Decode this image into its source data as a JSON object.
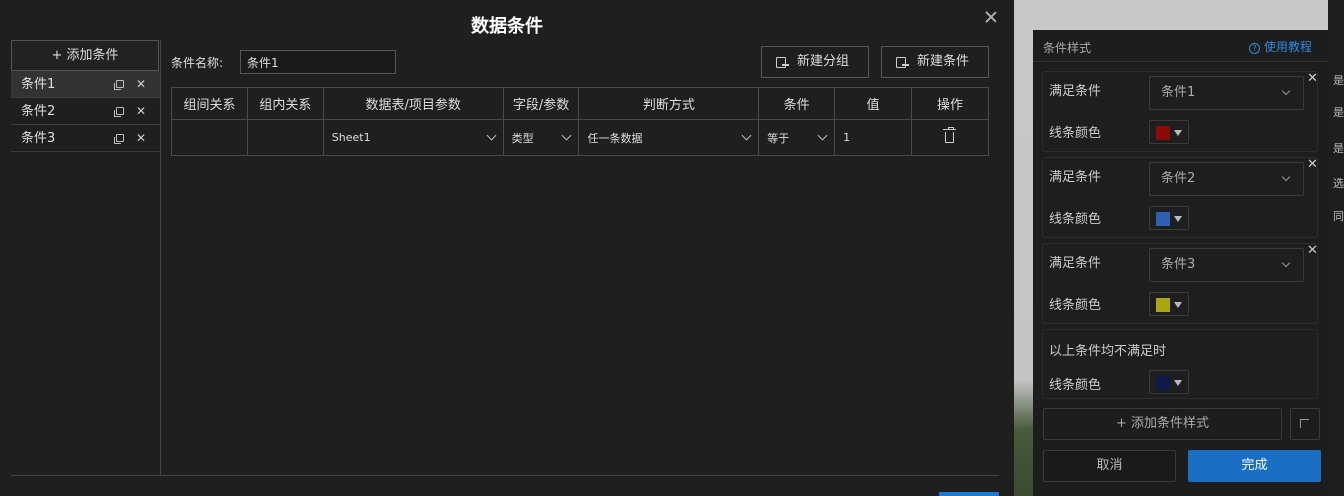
{
  "modal": {
    "title": "数据条件",
    "add_condition_label": "+ 添加条件",
    "conditions": [
      {
        "label": "条件1",
        "active": true
      },
      {
        "label": "条件2",
        "active": false
      },
      {
        "label": "条件3",
        "active": false
      }
    ],
    "name_label": "条件名称:",
    "name_value": "条件1",
    "new_group_label": "新建分组",
    "new_condition_label": "新建条件",
    "table": {
      "headers": [
        "组间关系",
        "组内关系",
        "数据表/项目参数",
        "字段/参数",
        "判断方式",
        "条件",
        "值",
        "操作"
      ],
      "row": {
        "inter_group": "",
        "intra_group": "",
        "table_param": "Sheet1",
        "field": "类型",
        "judge": "任一条数据",
        "condition": "等于",
        "value": "1"
      }
    }
  },
  "right_panel": {
    "title": "条件样式",
    "help_label": "使用教程",
    "cards": [
      {
        "label": "满足条件",
        "select": "条件1",
        "color_label": "线条颜色",
        "color": "#8b0a0a"
      },
      {
        "label": "满足条件",
        "select": "条件2",
        "color_label": "线条颜色",
        "color": "#2f5fb0"
      },
      {
        "label": "满足条件",
        "select": "条件3",
        "color_label": "线条颜色",
        "color": "#a9a60f"
      }
    ],
    "fallback": {
      "label": "以上条件均不满足时",
      "color_label": "线条颜色",
      "color": "#0d1a4a"
    },
    "add_style_label": "+ 添加条件样式",
    "cancel_label": "取消",
    "done_label": "完成"
  },
  "side_strip": [
    "是",
    "是",
    "是",
    "选",
    "同"
  ]
}
